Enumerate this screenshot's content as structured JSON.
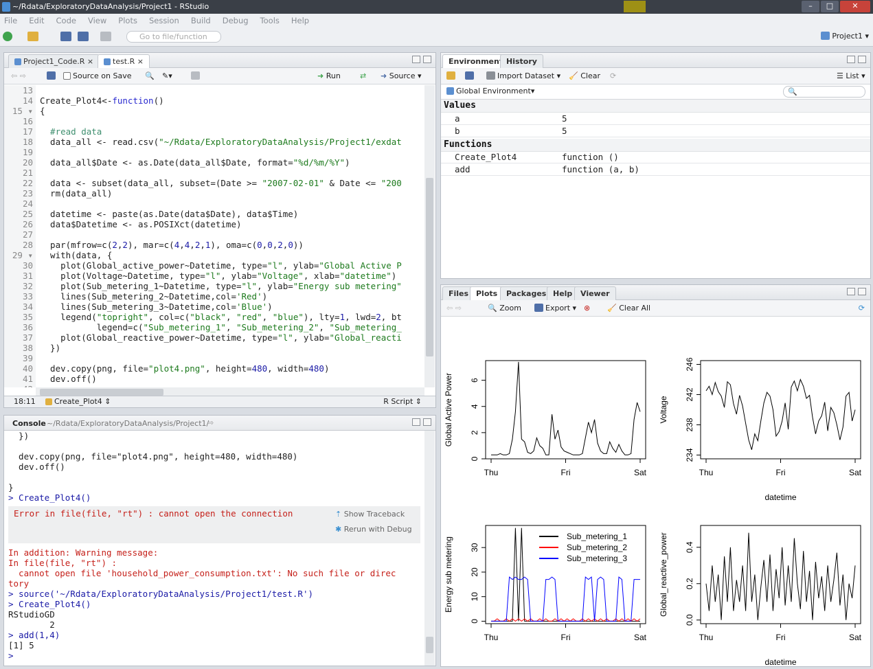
{
  "window": {
    "title": "~/Rdata/ExploratoryDataAnalysis/Project1 - RStudio"
  },
  "menu": [
    "File",
    "Edit",
    "Code",
    "View",
    "Plots",
    "Session",
    "Build",
    "Debug",
    "Tools",
    "Help"
  ],
  "toolbar": {
    "goto_placeholder": "Go to file/function",
    "project": "Project1"
  },
  "editor": {
    "tabs": [
      "Project1_Code.R",
      "test.R"
    ],
    "source_on_save": "Source on Save",
    "run": "Run",
    "source": "Source",
    "cursor": "18:11",
    "function_scope": "Create_Plot4",
    "filetype": "R Script",
    "line_numbers": [
      "13",
      "14",
      "15",
      "16",
      "17",
      "18",
      "19",
      "20",
      "21",
      "22",
      "23",
      "24",
      "25",
      "26",
      "27",
      "28",
      "29",
      "30",
      "31",
      "32",
      "33",
      "34",
      "35",
      "36",
      "37",
      "38",
      "39",
      "40",
      "41",
      "42"
    ],
    "lines": [
      "",
      "Create_Plot4<-function()",
      "{",
      "",
      "  #read data",
      "  data_all <- read.csv(\"~/Rdata/ExploratoryDataAnalysis/Project1/exdat",
      "",
      "  data_all$Date <- as.Date(data_all$Date, format=\"%d/%m/%Y\")",
      "",
      "  data <- subset(data_all, subset=(Date >= \"2007-02-01\" & Date <= \"200",
      "  rm(data_all)",
      "",
      "  datetime <- paste(as.Date(data$Date), data$Time)",
      "  data$Datetime <- as.POSIXct(datetime)",
      "",
      "  par(mfrow=c(2,2), mar=c(4,4,2,1), oma=c(0,0,2,0))",
      "  with(data, {",
      "    plot(Global_active_power~Datetime, type=\"l\", ylab=\"Global Active P",
      "    plot(Voltage~Datetime, type=\"l\", ylab=\"Voltage\", xlab=\"datetime\")",
      "    plot(Sub_metering_1~Datetime, type=\"l\", ylab=\"Energy sub metering\"",
      "    lines(Sub_metering_2~Datetime,col='Red')",
      "    lines(Sub_metering_3~Datetime,col='Blue')",
      "    legend(\"topright\", col=c(\"black\", \"red\", \"blue\"), lty=1, lwd=2, bt",
      "           legend=c(\"Sub_metering_1\", \"Sub_metering_2\", \"Sub_metering_",
      "    plot(Global_reactive_power~Datetime, type=\"l\", ylab=\"Global_reacti",
      "  })",
      "",
      "  dev.copy(png, file=\"plot4.png\", height=480, width=480)",
      "  dev.off()",
      ""
    ]
  },
  "console": {
    "title": "Console",
    "path": "~/Rdata/ExploratoryDataAnalysis/Project1/",
    "lines_before": [
      "  })",
      "",
      "  dev.copy(png, file=\"plot4.png\", height=480, width=480)",
      "  dev.off()",
      "",
      "}",
      "> Create_Plot4()"
    ],
    "error_text": "Error in file(file, \"rt\") : cannot open the connection",
    "show_traceback": "Show Traceback",
    "rerun_debug": "Rerun with Debug",
    "lines_after": [
      "In addition: Warning message:",
      "In file(file, \"rt\") :",
      "  cannot open file 'household_power_consumption.txt': No such file or direc",
      "tory",
      "> source('~/Rdata/ExploratoryDataAnalysis/Project1/test.R')",
      "> Create_Plot4()",
      "RStudioGD",
      "        2",
      "> add(1,4)",
      "[1] 5",
      "> "
    ]
  },
  "environment": {
    "tabs": [
      "Environment",
      "History"
    ],
    "import": "Import Dataset",
    "clear": "Clear",
    "view": "List",
    "scope": "Global Environment",
    "values_header": "Values",
    "values": [
      {
        "name": "a",
        "value": "5"
      },
      {
        "name": "b",
        "value": "5"
      }
    ],
    "functions_header": "Functions",
    "functions": [
      {
        "name": "Create_Plot4",
        "value": "function ()"
      },
      {
        "name": "add",
        "value": "function (a, b)"
      }
    ]
  },
  "plots_pane": {
    "tabs": [
      "Files",
      "Plots",
      "Packages",
      "Help",
      "Viewer"
    ],
    "zoom": "Zoom",
    "export": "Export",
    "clear_all": "Clear All"
  },
  "chart_data": [
    {
      "type": "line",
      "ylabel": "Global Active Power",
      "xlabel": "",
      "x_ticks": [
        "Thu",
        "Fri",
        "Sat"
      ],
      "y_ticks": [
        "0",
        "2",
        "4",
        "6"
      ],
      "ylim": [
        0,
        7.5
      ],
      "series": [
        {
          "color": "#000000",
          "values": [
            0.3,
            0.3,
            0.3,
            0.4,
            0.3,
            0.3,
            0.4,
            1.5,
            3.6,
            7.4,
            1.5,
            1.3,
            0.5,
            0.4,
            0.6,
            1.6,
            1.0,
            0.8,
            0.3,
            0.3,
            3.4,
            1.5,
            2.2,
            0.9,
            0.6,
            0.5,
            0.4,
            0.3,
            0.3,
            0.3,
            0.4,
            1.6,
            2.8,
            2.0,
            3.0,
            1.2,
            0.6,
            0.4,
            0.4,
            1.3,
            0.8,
            0.5,
            1.1,
            0.6,
            0.3,
            0.3,
            0.4,
            3.0,
            4.3,
            3.6
          ]
        }
      ]
    },
    {
      "type": "line",
      "ylabel": "Voltage",
      "xlabel": "datetime",
      "x_ticks": [
        "Thu",
        "Fri",
        "Sat"
      ],
      "y_ticks": [
        "234",
        "238",
        "242",
        "246"
      ],
      "ylim": [
        233.5,
        246.5
      ],
      "series": [
        {
          "color": "#000000",
          "values": [
            242.5,
            243.1,
            242.0,
            243.6,
            242.4,
            241.8,
            240.3,
            243.7,
            243.3,
            240.8,
            239.4,
            241.9,
            240.5,
            238.2,
            236.0,
            234.7,
            236.8,
            235.9,
            238.5,
            240.9,
            242.3,
            241.8,
            240.0,
            236.5,
            237.1,
            238.5,
            240.9,
            237.4,
            243.0,
            243.8,
            242.5,
            244.0,
            243.1,
            241.5,
            241.9,
            239.0,
            236.8,
            238.5,
            239.2,
            241.0,
            237.2,
            240.3,
            239.6,
            238.0,
            236.0,
            237.7,
            241.8,
            242.3,
            238.5,
            240.0
          ]
        }
      ]
    },
    {
      "type": "line",
      "ylabel": "Energy sub metering",
      "xlabel": "",
      "x_ticks": [
        "Thu",
        "Fri",
        "Sat"
      ],
      "y_ticks": [
        "0",
        "10",
        "20",
        "30"
      ],
      "ylim": [
        -1,
        39
      ],
      "legend": [
        "Sub_metering_1",
        "Sub_metering_2",
        "Sub_metering_3"
      ],
      "series": [
        {
          "name": "Sub_metering_1",
          "color": "#000000",
          "values": [
            0,
            0,
            0,
            0,
            0,
            0,
            0,
            0,
            38,
            0,
            38,
            0,
            0,
            0,
            0,
            0,
            0,
            0,
            0,
            0,
            0,
            0,
            0,
            0,
            0,
            0,
            0,
            0,
            0,
            0,
            0,
            0,
            0,
            0,
            0,
            0,
            0,
            0,
            0,
            0,
            0,
            0,
            0,
            0,
            0,
            0,
            0,
            0,
            0,
            0
          ]
        },
        {
          "name": "Sub_metering_2",
          "color": "#ff0000",
          "values": [
            0,
            0,
            1,
            0,
            0,
            1,
            0,
            1,
            0,
            1,
            0,
            1,
            0,
            1,
            0,
            0,
            1,
            0,
            1,
            0,
            0,
            1,
            0,
            1,
            0,
            1,
            0,
            1,
            0,
            0,
            1,
            0,
            1,
            0,
            1,
            0,
            1,
            0,
            1,
            0,
            0,
            1,
            0,
            1,
            0,
            1,
            0,
            1,
            0,
            1
          ]
        },
        {
          "name": "Sub_metering_3",
          "color": "#0000ff",
          "values": [
            0,
            0,
            0,
            0,
            0,
            0,
            18,
            17,
            18,
            17,
            17,
            18,
            17,
            0,
            0,
            0,
            0,
            0,
            17,
            17,
            18,
            17,
            0,
            0,
            0,
            0,
            0,
            0,
            0,
            0,
            0,
            18,
            17,
            18,
            0,
            17,
            18,
            17,
            0,
            0,
            0,
            0,
            18,
            17,
            0,
            0,
            0,
            17,
            17,
            17
          ]
        }
      ]
    },
    {
      "type": "line",
      "ylabel": "Global_reactive_power",
      "xlabel": "datetime",
      "x_ticks": [
        "Thu",
        "Fri",
        "Sat"
      ],
      "y_ticks": [
        "0.0",
        "0.2",
        "0.4"
      ],
      "ylim": [
        -0.02,
        0.52
      ],
      "series": [
        {
          "color": "#000000",
          "values": [
            0.2,
            0.05,
            0.3,
            0.1,
            0.25,
            0.0,
            0.35,
            0.1,
            0.4,
            0.05,
            0.22,
            0.1,
            0.3,
            0.05,
            0.48,
            0.1,
            0.25,
            0.0,
            0.18,
            0.33,
            0.1,
            0.36,
            0.05,
            0.28,
            0.12,
            0.4,
            0.08,
            0.3,
            0.1,
            0.45,
            0.2,
            0.06,
            0.38,
            0.1,
            0.27,
            0.0,
            0.32,
            0.12,
            0.24,
            0.05,
            0.3,
            0.1,
            0.22,
            0.37,
            0.08,
            0.25,
            0.0,
            0.2,
            0.12,
            0.3
          ]
        }
      ]
    }
  ]
}
